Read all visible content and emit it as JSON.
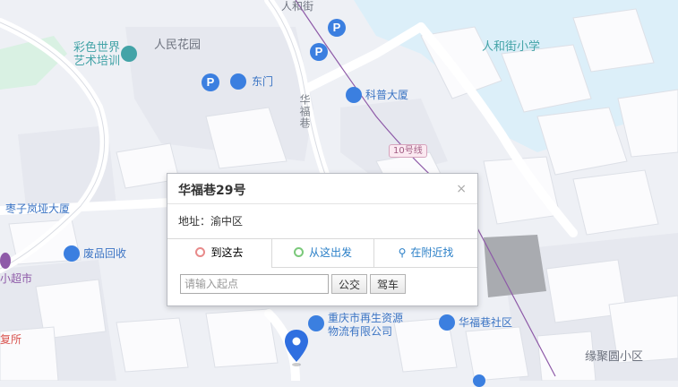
{
  "map_labels": {
    "renhe_jie_top": "人和街",
    "caise_art_1": "彩色世界",
    "caise_art_2": "艺术培训",
    "renmin_garden": "人民花园",
    "renhejie_school": "人和街小学",
    "dongmen": "东门",
    "kepu_building": "科普大厦",
    "huafu_alley": "华福巷",
    "metro_line": "10号线",
    "zaozi_building": "枣子岚垭大厦",
    "waste_recycle": "废品回收",
    "supermarket": "小超市",
    "fu_suo": "复所",
    "recycle_co_1": "重庆市再生资源",
    "recycle_co_2": "物流有限公司",
    "huafu_community": "华福巷社区",
    "yuanjuyuan": "缘聚圆小区"
  },
  "popup": {
    "title": "华福巷29号",
    "close": "×",
    "address_label": "地址：",
    "address_value": "渝中区",
    "tabs": [
      {
        "label": "到这去",
        "active": true
      },
      {
        "label": "从这出发",
        "active": false
      },
      {
        "label": "在附近找",
        "active": false
      }
    ],
    "start_placeholder": "请输入起点",
    "bus_button": "公交",
    "drive_button": "驾车"
  },
  "colors": {
    "poi_blue": "#3b7fe0",
    "teal": "#43a3a7",
    "water": "#dff0fa",
    "metro": "#8e5aa8"
  }
}
